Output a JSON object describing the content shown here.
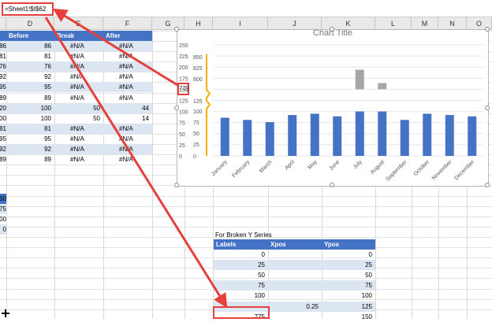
{
  "formula_bar": {
    "formula": "=Sheet1!$I$62"
  },
  "columns": [
    "D",
    "E",
    "F",
    "G",
    "H",
    "I",
    "J",
    "K",
    "L",
    "M",
    "N",
    "O"
  ],
  "left_table": {
    "headers": [
      "Before",
      "Break",
      "After"
    ],
    "rows": [
      [
        "86",
        "#N/A",
        "#N/A"
      ],
      [
        "81",
        "#N/A",
        "#N/A"
      ],
      [
        "76",
        "#N/A",
        "#N/A"
      ],
      [
        "92",
        "#N/A",
        "#N/A"
      ],
      [
        "95",
        "#N/A",
        "#N/A"
      ],
      [
        "89",
        "#N/A",
        "#N/A"
      ],
      [
        "100",
        "50",
        "44"
      ],
      [
        "100",
        "50",
        "14"
      ],
      [
        "81",
        "#N/A",
        "#N/A"
      ],
      [
        "95",
        "#N/A",
        "#N/A"
      ],
      [
        "92",
        "#N/A",
        "#N/A"
      ],
      [
        "89",
        "#N/A",
        "#N/A"
      ]
    ],
    "cut_left_column": [
      "86",
      "81",
      "76",
      "92",
      "95",
      "89",
      "20",
      "00",
      "81",
      "95",
      "92",
      "89"
    ],
    "lower_cut_values": [
      "50",
      "75",
      "00",
      "0"
    ]
  },
  "chart": {
    "title": "Chart Title",
    "left_ticks": [
      "250",
      "225",
      "200",
      "175",
      "150",
      "125",
      "100",
      "75",
      "50",
      "25",
      "0"
    ],
    "right_ticks": [
      "850",
      "825",
      "800",
      "775",
      "125",
      "100",
      "75",
      "50",
      "25",
      "0"
    ],
    "selected_label": "775"
  },
  "chart_data": {
    "type": "bar",
    "title": "Chart Title",
    "categories": [
      "January",
      "February",
      "March",
      "April",
      "May",
      "June",
      "July",
      "August",
      "September",
      "October",
      "November",
      "December"
    ],
    "series": [
      {
        "values": [
          86,
          81,
          76,
          92,
          95,
          89,
          100,
          100,
          81,
          95,
          92,
          89
        ],
        "color": "#4472c4"
      },
      {
        "values": [
          null,
          null,
          null,
          null,
          null,
          null,
          44,
          14,
          null,
          null,
          null,
          null
        ],
        "color": "#a6a6a6"
      }
    ],
    "ylim": [
      0,
      250
    ]
  },
  "broken_y": {
    "title": "For Broken Y Series",
    "headers": [
      "Labels",
      "Xpos",
      "Ypos"
    ],
    "rows": [
      [
        "0",
        "",
        "0"
      ],
      [
        "25",
        "",
        "25"
      ],
      [
        "50",
        "",
        "50"
      ],
      [
        "75",
        "",
        "75"
      ],
      [
        "100",
        "",
        "100"
      ],
      [
        "",
        "0.25",
        "125"
      ],
      [
        "775",
        "",
        "150"
      ]
    ]
  },
  "accent_color": "#4472c4",
  "arrow_color": "#e5403c"
}
